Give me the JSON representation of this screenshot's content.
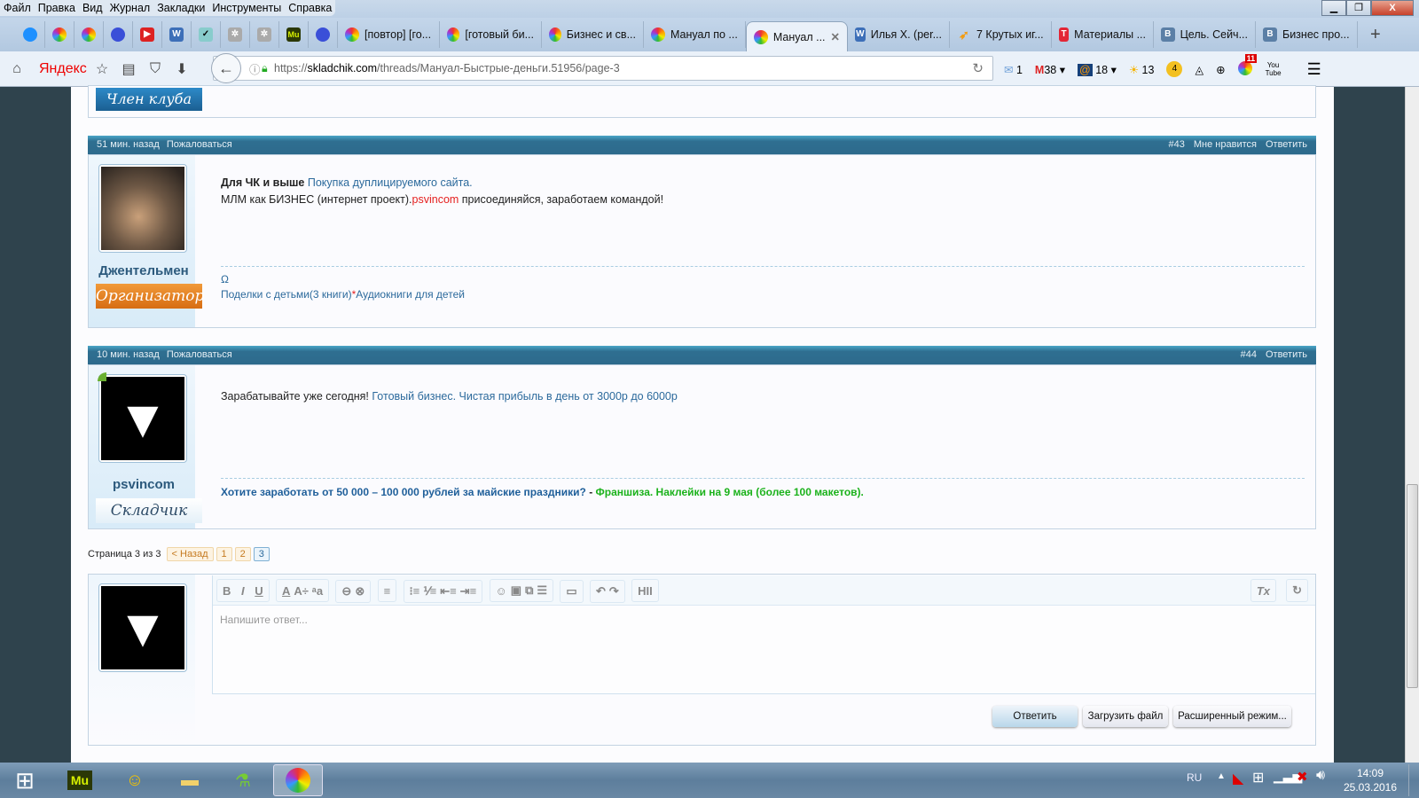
{
  "menu": [
    "Файл",
    "Правка",
    "Вид",
    "Журнал",
    "Закладки",
    "Инструменты",
    "Справка"
  ],
  "window_buttons": {
    "minimize": "▁",
    "restore": "❐",
    "close": "X"
  },
  "pinned_tabs": [
    {
      "icon": "rostelecom-icon",
      "color": "#1e90ff"
    },
    {
      "icon": "firefox-icon"
    },
    {
      "icon": "firefox-icon"
    },
    {
      "icon": "blue-flower-icon",
      "color": "#3a4fd8"
    },
    {
      "icon": "youtube-icon",
      "color": "#d22"
    },
    {
      "icon": "word-icon",
      "color": "#3d6fb8"
    },
    {
      "icon": "check-icon",
      "color": "#2a2"
    },
    {
      "icon": "gear-icon",
      "color": "#999"
    },
    {
      "icon": "gear-icon",
      "color": "#999"
    },
    {
      "icon": "muse-icon",
      "color": "#3b4d08"
    },
    {
      "icon": "blue-flower-icon",
      "color": "#3a4fd8"
    }
  ],
  "tabs": [
    {
      "label": "[повтор] [го...",
      "icon": "firefox-icon"
    },
    {
      "label": "[готовый би...",
      "icon": "firefox-icon"
    },
    {
      "label": "Бизнес и св...",
      "icon": "firefox-icon"
    },
    {
      "label": "Мануал по ...",
      "icon": "firefox-icon"
    },
    {
      "label": "Мануал ...",
      "icon": "firefox-icon",
      "active": true
    },
    {
      "label": "Илья Х. (per...",
      "icon": "word-icon"
    },
    {
      "label": "7 Крутых иг...",
      "icon": "rocket-icon"
    },
    {
      "label": "Материалы ...",
      "icon": "t-icon"
    },
    {
      "label": "Цель. Сейч...",
      "icon": "vk-icon"
    },
    {
      "label": "Бизнес про...",
      "icon": "vk-icon"
    }
  ],
  "new_tab": "+",
  "nav": {
    "yandex": "Яндекс",
    "url_prefix": "https://",
    "url_domain": "skladchik.com",
    "url_path": "/threads/Мануал-Быстрые-деньги.51956/page-3",
    "mail_count": "1",
    "gmail_count": "38",
    "mailru_count": "18",
    "weather": "13",
    "badge4": "4",
    "notif_count": "11",
    "youtube": "You Tube"
  },
  "top_rank": "Член клуба",
  "posts": [
    {
      "time": "51 мин. назад",
      "report": "Пожаловаться",
      "number": "#43",
      "like": "Мне нравится",
      "reply": "Ответить",
      "username": "Джентельмен",
      "rank": "Организатор",
      "line1_bold": "Для ЧК и выше",
      "line1_link": "Покупка дуплицируемого сайта.",
      "line2_text": "МЛМ как БИЗНЕС (интернет проект).",
      "line2_red": "psvincom",
      "line2_rest": " присоединяйся, заработаем командой!",
      "sig_symbol": "Ω",
      "sig_link1": "Поделки с детьми(3 книги)",
      "sig_star": "*",
      "sig_link2": "Аудиокниги для детей"
    },
    {
      "time": "10 мин. назад",
      "report": "Пожаловаться",
      "number": "#44",
      "reply": "Ответить",
      "username": "psvincom",
      "rank": "Складчик",
      "text": "Зарабатывайте уже сегодня!",
      "link": "Готовый бизнес. Чистая прибыль в день от 3000р до 6000р",
      "sig_blue": "Хотите заработать от 50 000 – 100 000 рублей за майские праздники?",
      "sig_dash": " - ",
      "sig_green": "Франшиза. Наклейки на 9 мая (более 100 макетов)."
    }
  ],
  "pagination": {
    "label": "Страница 3 из 3",
    "prev": "< Назад",
    "pages": [
      "1",
      "2",
      "3"
    ],
    "current": "3"
  },
  "editor": {
    "placeholder": "Напишите ответ...",
    "toolbar": [
      "B",
      "I",
      "U",
      "A",
      "A÷",
      "ᵃa",
      "⊖",
      "⊗",
      "≡",
      "⁝≡",
      "⅟≡",
      "⇤≡",
      "⇥≡",
      "☺",
      "▣",
      "⧉",
      "☰",
      "▭",
      "↶",
      "↷",
      "HII"
    ],
    "clear_format": "Tx",
    "restore": "↻"
  },
  "buttons": {
    "reply": "Ответить",
    "upload": "Загрузить файл",
    "advanced": "Расширенный режим..."
  },
  "taskbar": {
    "lang": "RU",
    "time": "14:09",
    "date": "25.03.2016"
  },
  "colors": {
    "header": "#2d6a8c",
    "organizer": "#e07a22",
    "member": "#1f6ca3",
    "link": "#2c6a9c",
    "red": "#e52020",
    "green": "#1bb21b"
  }
}
